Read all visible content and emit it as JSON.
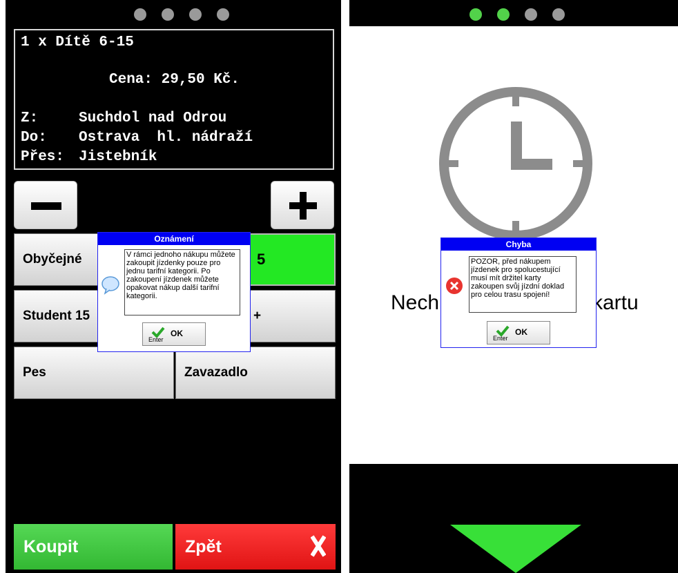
{
  "left_screen": {
    "ticket": {
      "quantity_line": "1 x Dítě 6-15",
      "price_line": "Cena: 29,50 Kč.",
      "from_label": "Z:",
      "from_value": "Suchdol nad Odrou",
      "to_label": "Do:",
      "to_value": "Ostrava  hl. nádraží",
      "via_label": "Přes:",
      "via_value": "Jistebník"
    },
    "categories": [
      {
        "label": "Obyčejné"
      },
      {
        "label": "5"
      },
      {
        "label": "Student 15"
      },
      {
        "label": "+"
      },
      {
        "label": "Pes"
      },
      {
        "label": "Zavazadlo"
      }
    ],
    "buy_label": "Koupit",
    "back_label": "Zpět",
    "dialog": {
      "title": "Oznámení",
      "message": "V rámci jednoho nákupu můžete zakoupit jízdenky pouze pro jednu tarifní kategorii. Po zakoupení jízdenek můžete opakovat nákup další tarifní kategorii.",
      "ok_label": "OK",
      "enter_label": "Enter"
    }
  },
  "right_screen": {
    "prompt_left": "Nech",
    "prompt_right": "kartu",
    "dialog": {
      "title": "Chyba",
      "message": "POZOR, před nákupem jízdenek pro spolucestující musí mít držitel karty zakoupen svůj jízdní doklad pro celou trasu spojení!",
      "ok_label": "OK",
      "enter_label": "Enter"
    }
  },
  "colors": {
    "buy_green": "#3fc43f",
    "back_red": "#f01e1e",
    "active_category": "#23e823",
    "dialog_title_blue": "#0000f2",
    "step_dot_active": "#52d24a",
    "arrow_green": "#38e038"
  }
}
